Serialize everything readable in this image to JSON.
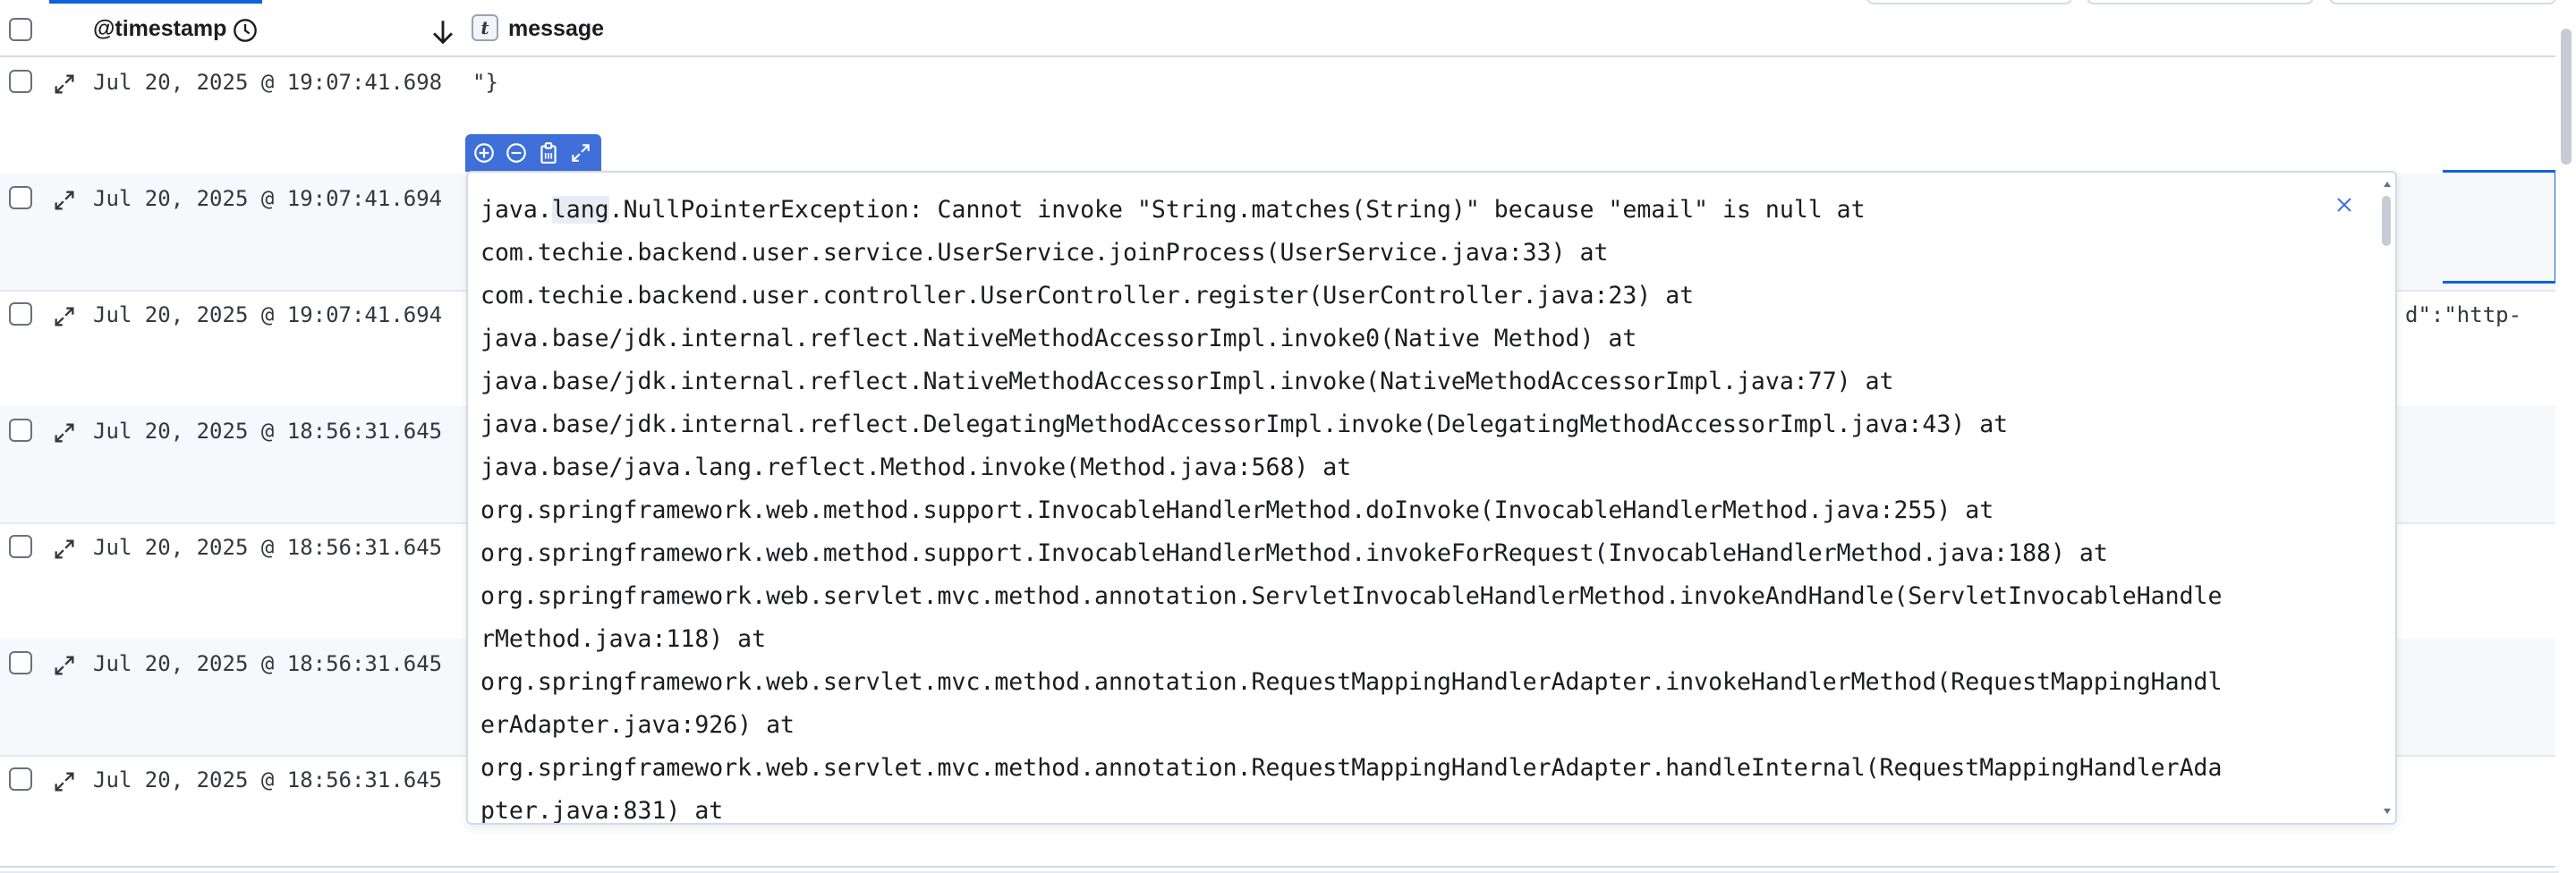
{
  "header": {
    "timestamp_label": "@timestamp",
    "field_type_badge": "t",
    "message_label": "message",
    "icons": {
      "timestamp": "clock-icon",
      "sort": "sort-down-arrow-icon"
    }
  },
  "rows": [
    {
      "timestamp": "Jul 20, 2025 @ 19:07:41.698",
      "message": "\"}"
    },
    {
      "timestamp": "Jul 20, 2025 @ 19:07:41.694",
      "message": ""
    },
    {
      "timestamp": "Jul 20, 2025 @ 19:07:41.694",
      "message": "d\":\"http-"
    },
    {
      "timestamp": "Jul 20, 2025 @ 18:56:31.645",
      "message": ""
    },
    {
      "timestamp": "Jul 20, 2025 @ 18:56:31.645",
      "message": ""
    },
    {
      "timestamp": "Jul 20, 2025 @ 18:56:31.645",
      "message": ""
    },
    {
      "timestamp": "Jul 20, 2025 @ 18:56:31.645",
      "message": ""
    }
  ],
  "popover": {
    "toolbar_icons": [
      "zoom-in-icon",
      "zoom-out-icon",
      "copy-icon",
      "fullscreen-icon"
    ],
    "close_icon": "close-icon",
    "lines": [
      {
        "pre": "java.",
        "hl": "lang",
        "post": ".NullPointerException: Cannot invoke \"String.matches(String)\" because \"email\" is null at"
      },
      {
        "pre": "com.techie.backend.user.service.UserService.joinProcess(UserService.java:33) at",
        "hl": "",
        "post": ""
      },
      {
        "pre": "com.techie.backend.user.controller.UserController.register(UserController.java:23) at",
        "hl": "",
        "post": ""
      },
      {
        "pre": "java.base/jdk.internal.reflect.NativeMethodAccessorImpl.invoke0(Native Method) at",
        "hl": "",
        "post": ""
      },
      {
        "pre": "java.base/jdk.internal.reflect.NativeMethodAccessorImpl.invoke(NativeMethodAccessorImpl.java:77) at",
        "hl": "",
        "post": ""
      },
      {
        "pre": "java.base/jdk.internal.reflect.DelegatingMethodAccessorImpl.invoke(DelegatingMethodAccessorImpl.java:43) at",
        "hl": "",
        "post": ""
      },
      {
        "pre": "java.base/java.lang.reflect.Method.invoke(Method.java:568) at",
        "hl": "",
        "post": ""
      },
      {
        "pre": "org.springframework.web.method.support.InvocableHandlerMethod.doInvoke(InvocableHandlerMethod.java:255) at",
        "hl": "",
        "post": ""
      },
      {
        "pre": "org.springframework.web.method.support.InvocableHandlerMethod.invokeForRequest(InvocableHandlerMethod.java:188) at",
        "hl": "",
        "post": ""
      },
      {
        "pre": "org.springframework.web.servlet.mvc.method.annotation.ServletInvocableHandlerMethod.invokeAndHandle(ServletInvocableHandle",
        "hl": "",
        "post": ""
      },
      {
        "pre": "rMethod.java:118) at",
        "hl": "",
        "post": ""
      },
      {
        "pre": "org.springframework.web.servlet.mvc.method.annotation.RequestMappingHandlerAdapter.invokeHandlerMethod(RequestMappingHandl",
        "hl": "",
        "post": ""
      },
      {
        "pre": "erAdapter.java:926) at",
        "hl": "",
        "post": ""
      },
      {
        "pre": "org.springframework.web.servlet.mvc.method.annotation.RequestMappingHandlerAdapter.handleInternal(RequestMappingHandlerAda",
        "hl": "",
        "post": ""
      },
      {
        "pre": "pter.java:831) at",
        "hl": "",
        "post": ""
      }
    ]
  },
  "colors": {
    "accent": "#0b64dd",
    "toolbar": "#3f6fd8",
    "border": "#d3dae6",
    "row_alt": "#f7f8fc",
    "text": "#1a1c21"
  }
}
